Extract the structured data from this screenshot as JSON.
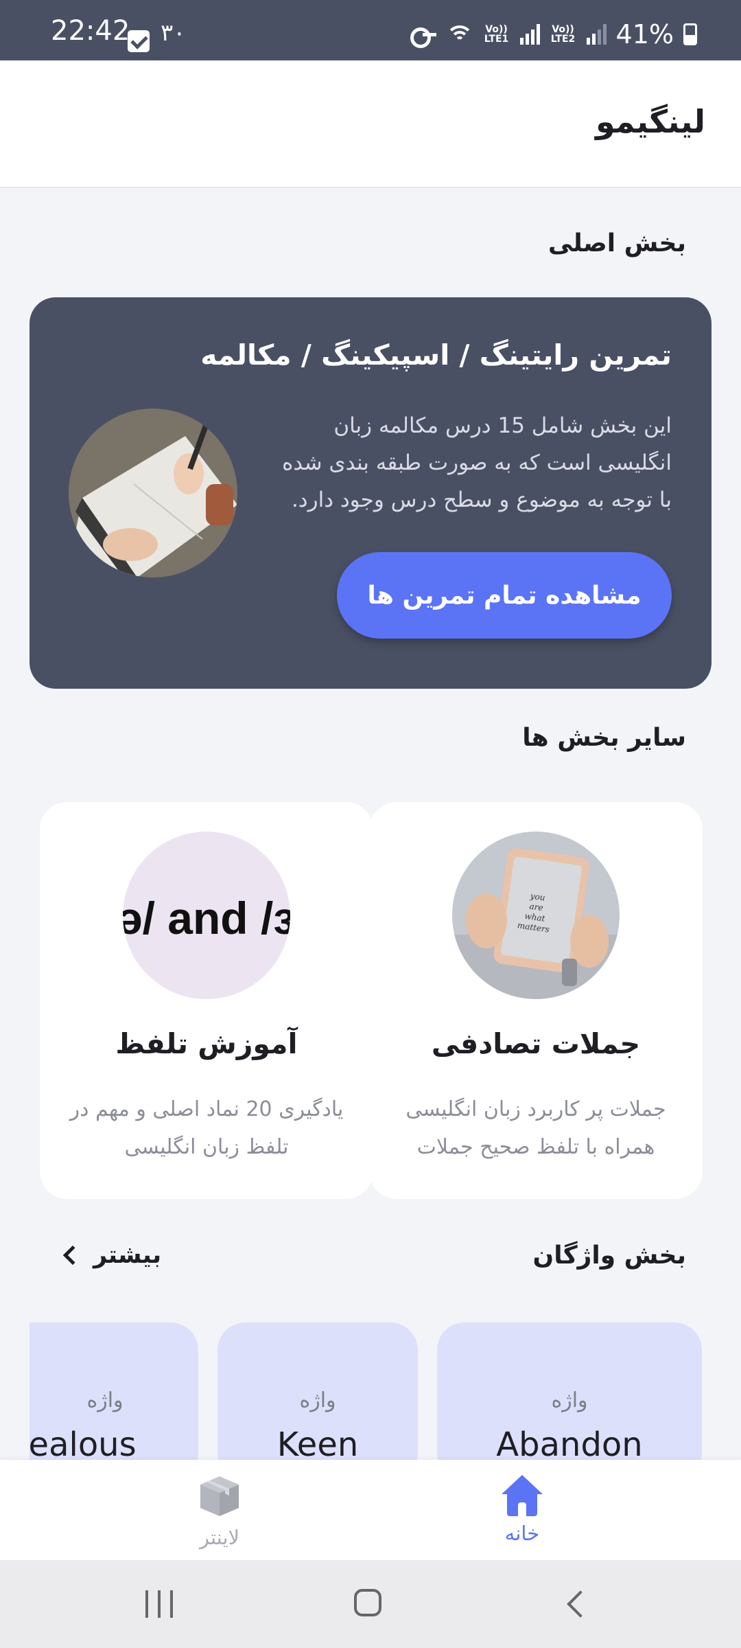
{
  "status_bar": {
    "time": "22:42",
    "notification_count": "۳۰",
    "battery": "41%",
    "lte1": "Vo)) LTE1",
    "lte2": "Vo)) LTE2"
  },
  "app": {
    "title": "لینگیمو"
  },
  "main_section": {
    "title": "بخش اصلی",
    "card": {
      "title": "تمرین رایتینگ / اسپیکینگ / مکالمه",
      "description": "این بخش شامل 15 درس مکالمه زبان انگلیسی است که به صورت طبقه بندی شده با توجه به موضوع و سطح درس وجود دارد.",
      "button_label": "مشاهده تمام تمرین ها",
      "image_icon": "writing-notebook-photo"
    }
  },
  "other_sections": {
    "title": "سایر بخش ها",
    "items": [
      {
        "title": "جملات تصادفی",
        "description": "جملات پر کاربرد زبان انگلیسی همراه با تلفظ صحیح جملات",
        "image_icon": "tablet-photo"
      },
      {
        "title": "آموزش تلفظ",
        "description": "یادگیری 20 نماد اصلی و مهم در تلفظ زبان انگلیسی",
        "image_text": "ə/ and /ɜ"
      }
    ]
  },
  "vocab_section": {
    "title": "بخش واژگان",
    "more_label": "بیشتر",
    "cards": [
      {
        "tag": "واژه",
        "word": "Abandon"
      },
      {
        "tag": "واژه",
        "word": "Keen"
      },
      {
        "tag": "واژه",
        "word": "Jealous"
      }
    ]
  },
  "bottom_nav": {
    "items": [
      {
        "label": "خانه",
        "icon": "home-icon",
        "active": true
      },
      {
        "label": "لاینتر",
        "icon": "box-icon",
        "active": false
      }
    ]
  },
  "colors": {
    "accent": "#5b74f5",
    "card_dark": "#4a5064",
    "vocab_bg": "#dde0fb"
  }
}
